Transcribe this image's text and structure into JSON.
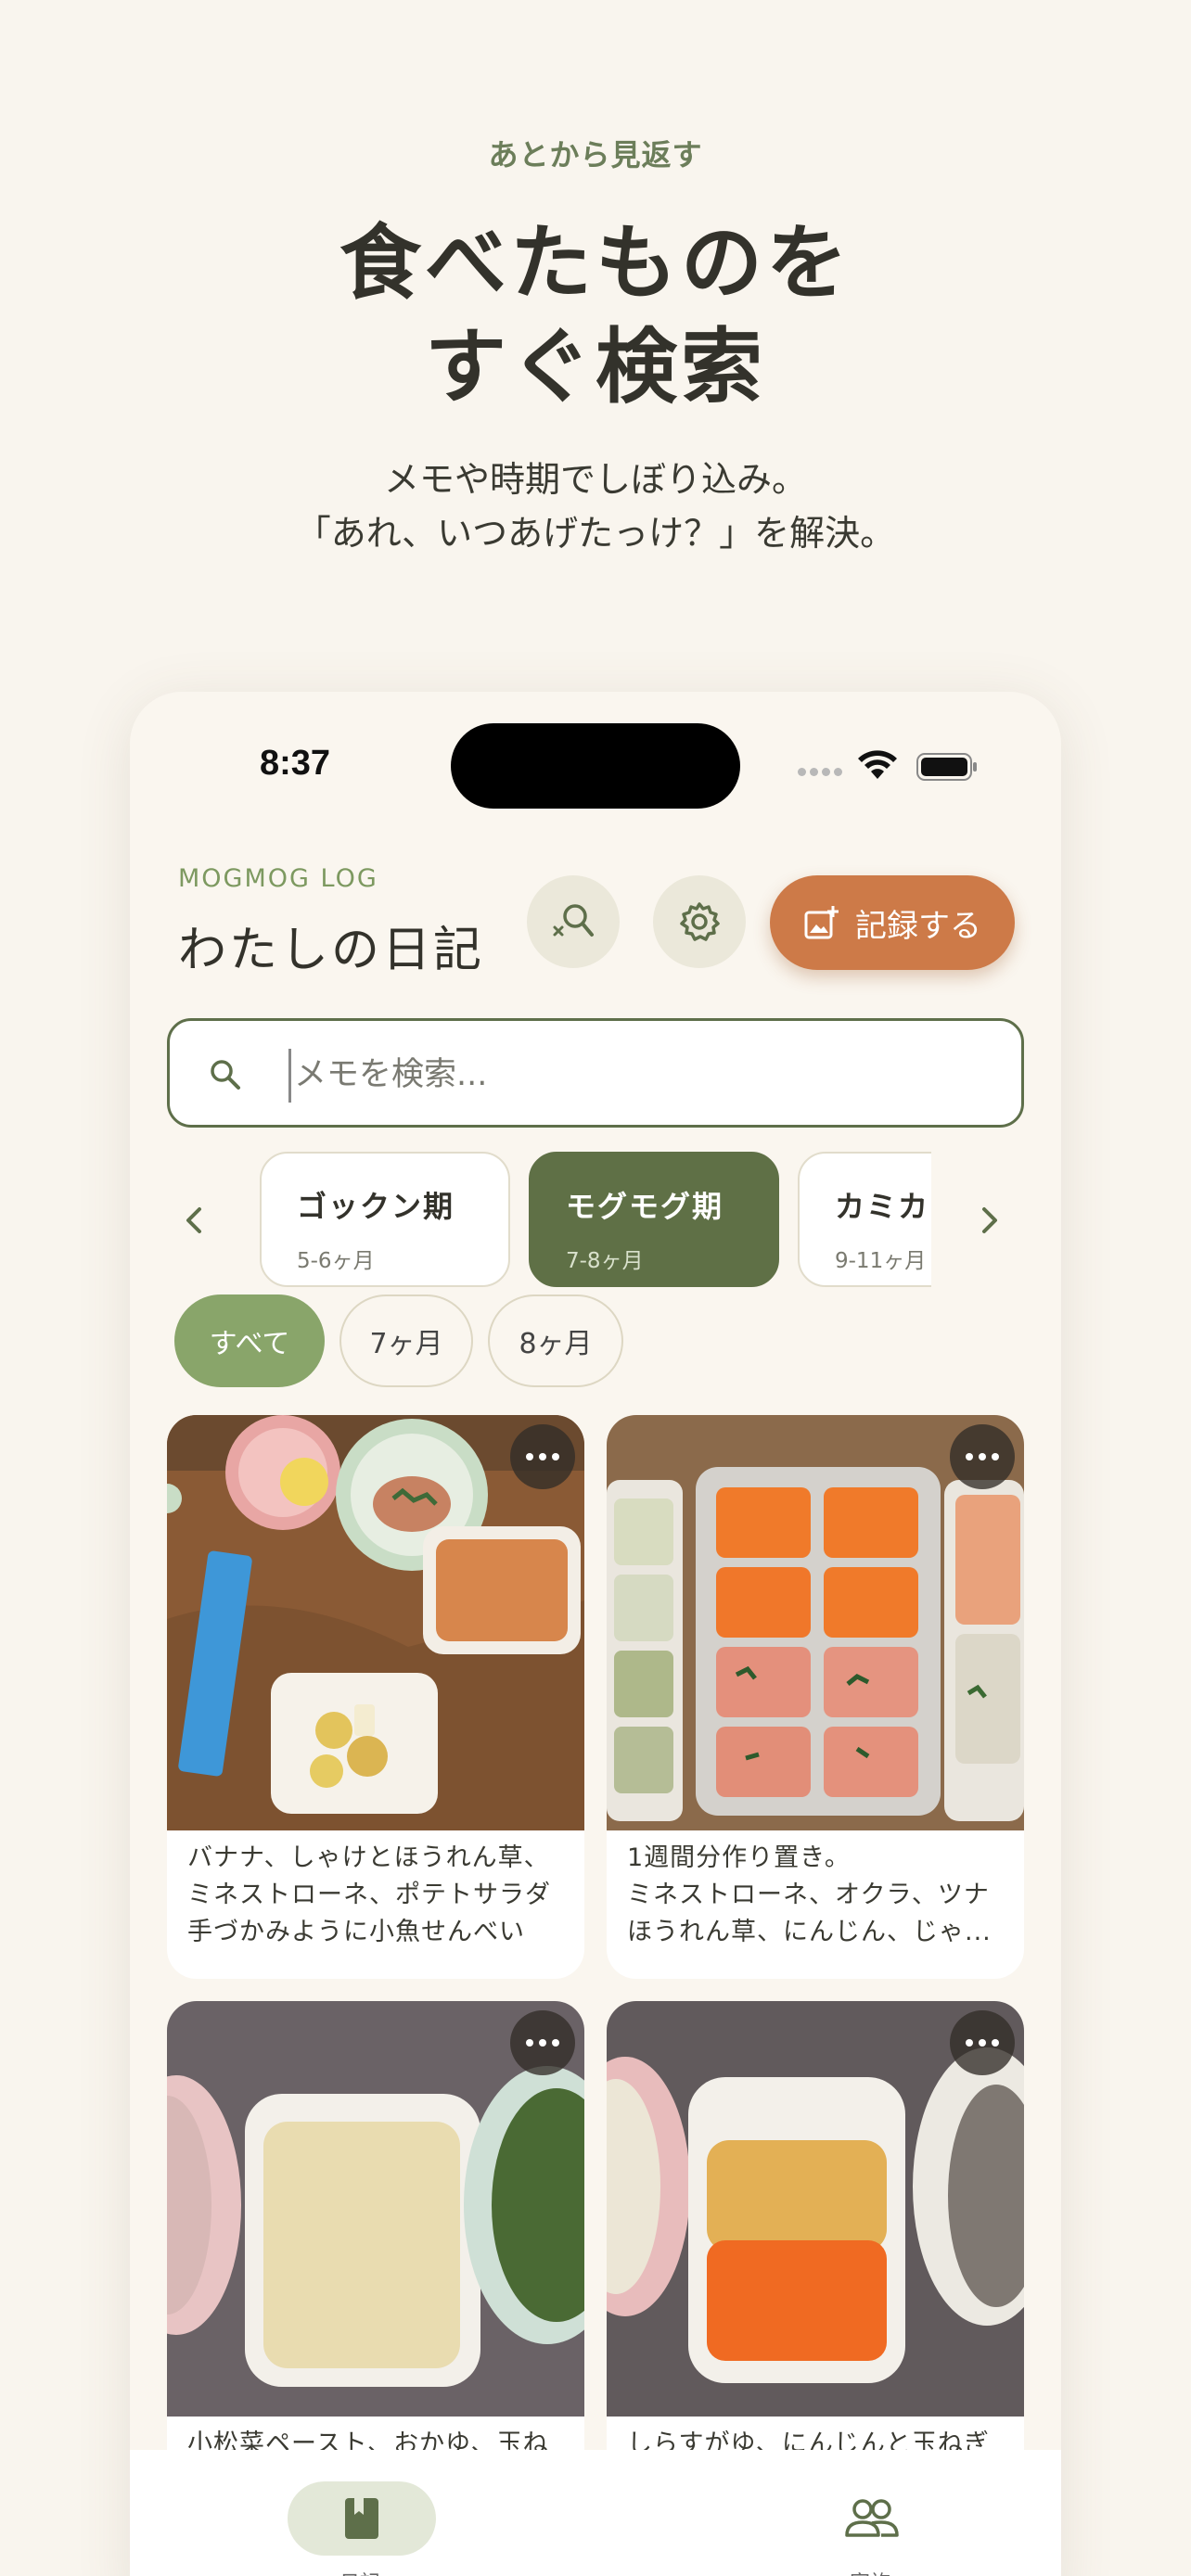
{
  "promo": {
    "eyebrow": "あとから見返す",
    "title_line1": "食べたものを",
    "title_line2": "すぐ検索",
    "sub_line1": "メモや時期でしぼり込み。",
    "sub_line2": "「あれ、いつあげたっけ？」を解決。"
  },
  "status_bar": {
    "time": "8:37"
  },
  "header": {
    "brand": "MOGMOG LOG",
    "title": "わたしの日記",
    "record_label": "記録する"
  },
  "search": {
    "placeholder": "メモを検索..."
  },
  "stages": [
    {
      "name": "ゴックン期",
      "range": "5-6ヶ月",
      "active": false
    },
    {
      "name": "モグモグ期",
      "range": "7-8ヶ月",
      "active": true
    },
    {
      "name": "カミカ",
      "range": "9-11ヶ月",
      "active": false
    }
  ],
  "months": [
    {
      "label": "すべて",
      "active": true
    },
    {
      "label": "7ヶ月",
      "active": false
    },
    {
      "label": "8ヶ月",
      "active": false
    }
  ],
  "entries": [
    {
      "memo": "バナナ、しゃけとほうれん草、\nミネストローネ、ポテトサラダ\n手づかみように小魚せんべい"
    },
    {
      "memo": "1週間分作り置き。\nミネストローネ、オクラ、ツナ\nほうれん草、にんじん、じゃ..."
    },
    {
      "memo": "小松菜ペースト、おかゆ、玉ね"
    },
    {
      "memo": "しらすがゆ、にんじんと玉ねぎ"
    }
  ],
  "tabs": [
    {
      "label": "日記",
      "icon": "book-icon",
      "active": true
    },
    {
      "label": "家族",
      "icon": "people-icon",
      "active": false
    }
  ],
  "colors": {
    "background": "#f9f5ee",
    "accent_green": "#5f7046",
    "chip_green": "#89a56a",
    "record_orange": "#cd7a48"
  }
}
